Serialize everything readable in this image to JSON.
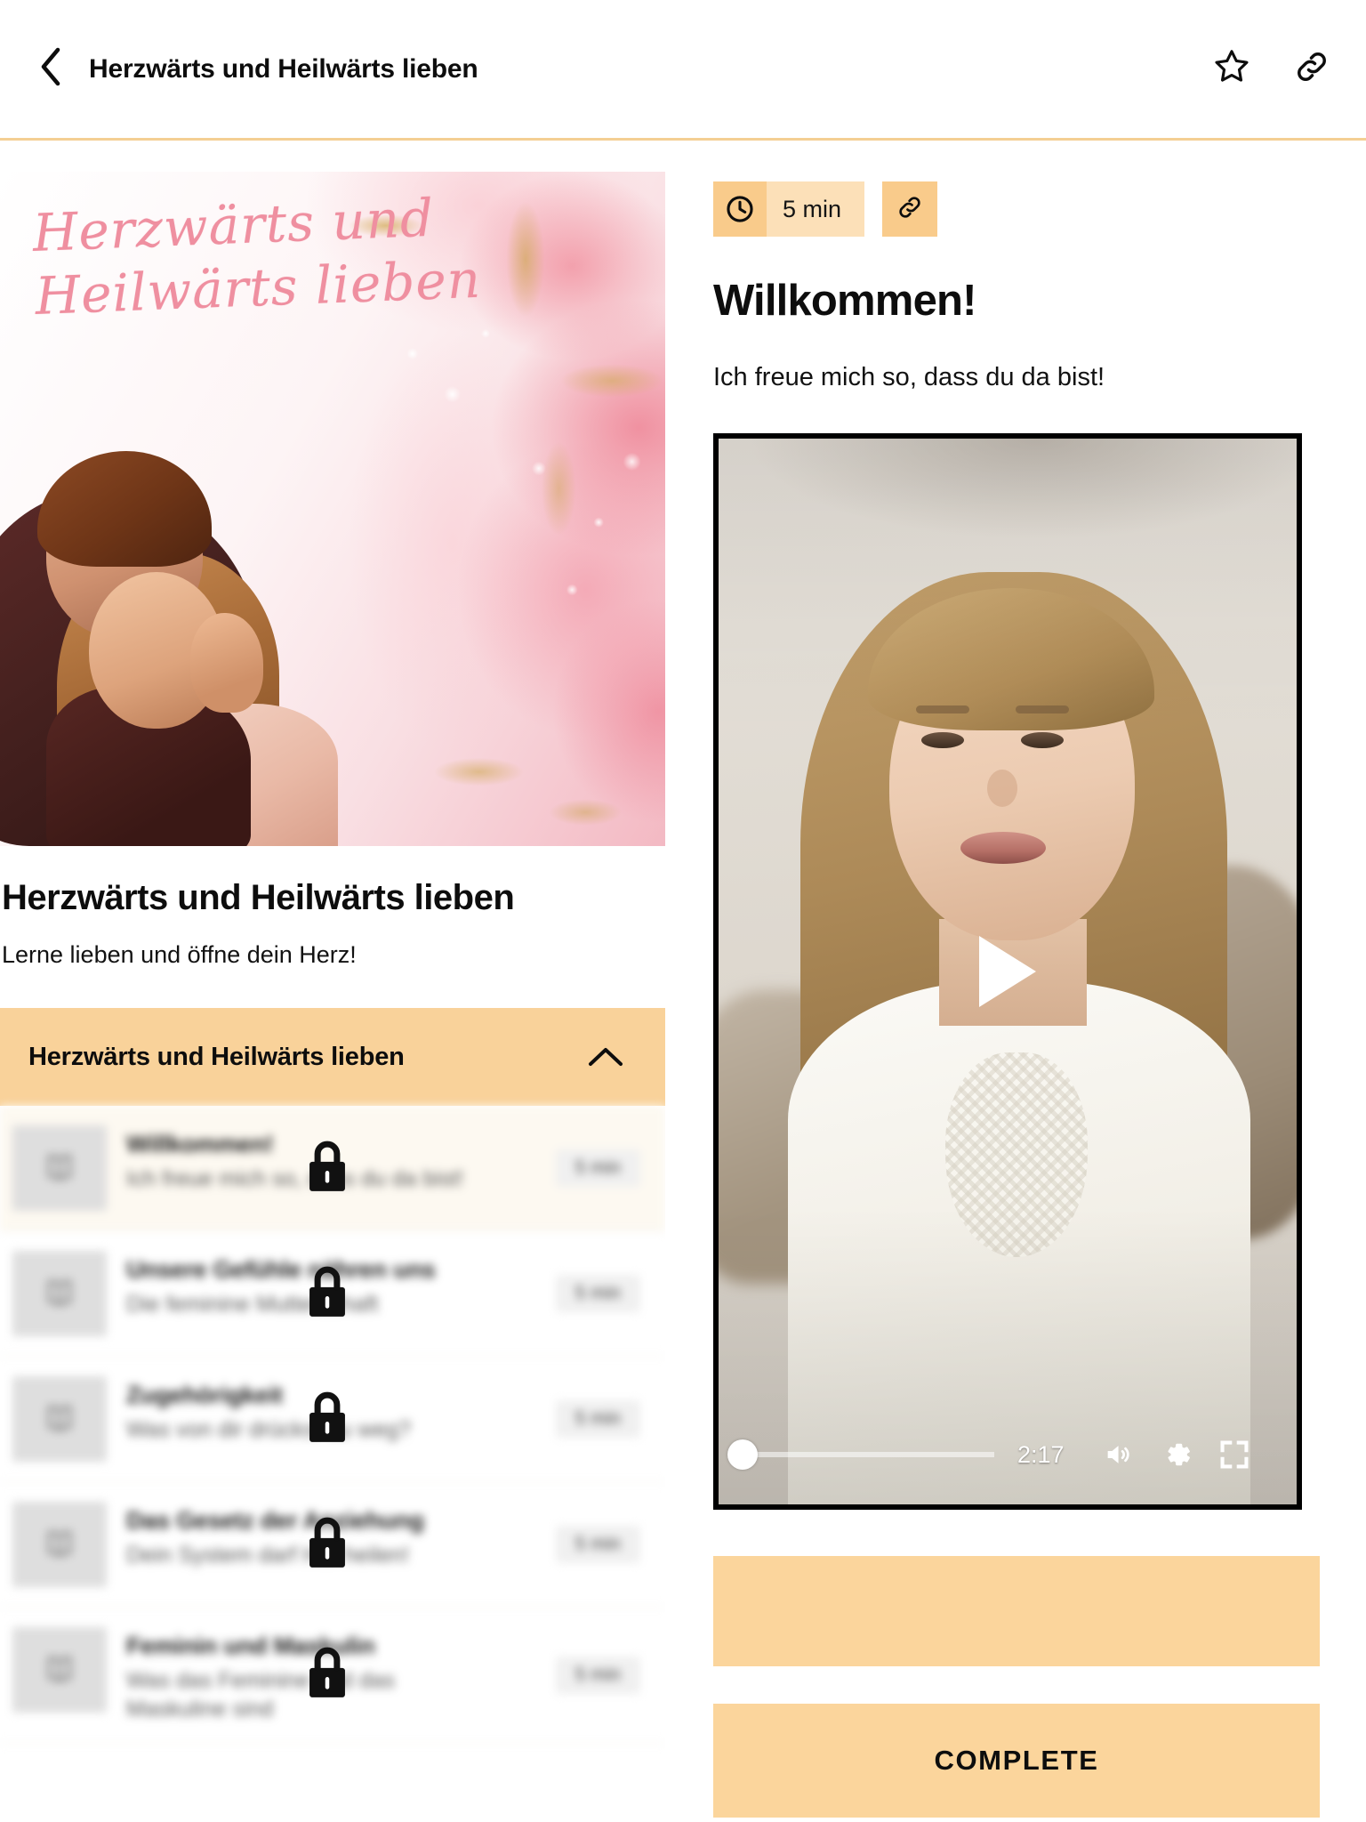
{
  "topbar": {
    "back_icon": "chevron-left-icon",
    "title": "Herzwärts und Heilwärts lieben",
    "favorite_icon": "star-icon",
    "share_icon": "link-icon"
  },
  "course": {
    "cover_line1": "Herzwärts und",
    "cover_line2": "Heilwärts lieben",
    "title": "Herzwärts und Heilwärts lieben",
    "subtitle": "Lerne lieben und öffne dein Herz!"
  },
  "accordion": {
    "label": "Herzwärts und Heilwärts lieben",
    "chevron_icon": "chevron-up-icon",
    "expanded": true
  },
  "lessons": [
    {
      "title": "Willkommen!",
      "desc": "Ich freue mich so, dass du da bist!",
      "duration": "5 min",
      "locked": true,
      "active": true,
      "icon": "book-icon",
      "lock_icon": "lock-icon"
    },
    {
      "title": "Unsere Gefühle nähren uns",
      "desc": "Die feminine Mutterschaft",
      "duration": "5 min",
      "locked": true,
      "active": false,
      "icon": "book-icon",
      "lock_icon": "lock-icon"
    },
    {
      "title": "Zugehörigkeit",
      "desc": "Was von dir drückst du weg?",
      "duration": "5 min",
      "locked": true,
      "active": false,
      "icon": "book-icon",
      "lock_icon": "lock-icon"
    },
    {
      "title": "Das Gesetz der Anziehung",
      "desc": "Dein System darf Hte heilen!",
      "duration": "5 min",
      "locked": true,
      "active": false,
      "icon": "book-icon",
      "lock_icon": "lock-icon"
    },
    {
      "title": "Feminin und Maskulin",
      "desc": "Was das Feminine und das Maskuline sind",
      "duration": "5 min",
      "locked": true,
      "active": false,
      "icon": "book-icon",
      "lock_icon": "lock-icon"
    }
  ],
  "lesson": {
    "duration_icon": "clock-icon",
    "duration": "5 min",
    "share_icon": "link-icon",
    "heading": "Willkommen!",
    "intro": "Ich freue mich so, dass du da bist!"
  },
  "video": {
    "play_icon": "play-icon",
    "time": "2:17",
    "volume_icon": "volume-icon",
    "settings_icon": "gear-icon",
    "fullscreen_icon": "fullscreen-icon",
    "progress_percent": 0
  },
  "actions": {
    "secondary_label": "",
    "complete_label": "COMPLETE"
  },
  "colors": {
    "accent_orange": "#fbd59c",
    "accent_orange_dark": "#f9cb8b",
    "accent_orange_light": "#fce0b8",
    "divider": "#f4cf93",
    "active_row": "#fdf9f1",
    "text": "#0d0d0d"
  }
}
